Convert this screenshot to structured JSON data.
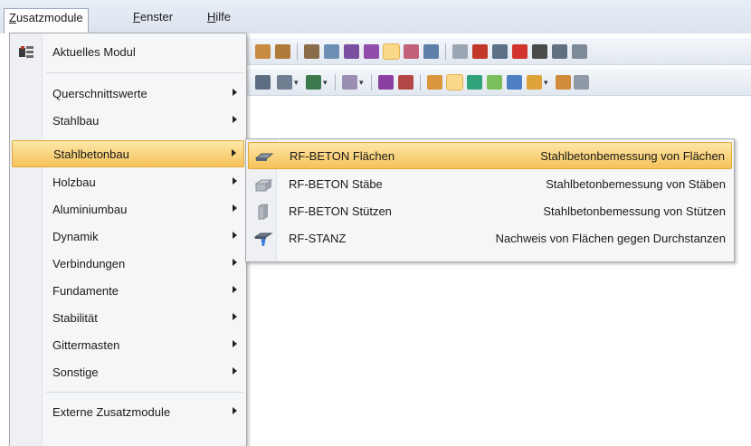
{
  "menubar": {
    "items": [
      {
        "mnemonic": "Z",
        "rest": "usatzmodule"
      },
      {
        "mnemonic": "F",
        "rest": "enster"
      },
      {
        "mnemonic": "H",
        "rest": "ilfe"
      }
    ]
  },
  "menu": {
    "items": [
      {
        "label": "Aktuelles Modul",
        "has_submenu": false,
        "icon": "module-icon"
      },
      {
        "label": "Querschnittswerte",
        "has_submenu": true
      },
      {
        "label": "Stahlbau",
        "has_submenu": true
      },
      {
        "label": "Stahlbetonbau",
        "has_submenu": true,
        "highlighted": true
      },
      {
        "label": "Holzbau",
        "has_submenu": true
      },
      {
        "label": "Aluminiumbau",
        "has_submenu": true
      },
      {
        "label": "Dynamik",
        "has_submenu": true
      },
      {
        "label": "Verbindungen",
        "has_submenu": true
      },
      {
        "label": "Fundamente",
        "has_submenu": true
      },
      {
        "label": "Stabilität",
        "has_submenu": true
      },
      {
        "label": "Gittermasten",
        "has_submenu": true
      },
      {
        "label": "Sonstige",
        "has_submenu": true
      },
      {
        "label": "Externe Zusatzmodule",
        "has_submenu": true
      }
    ]
  },
  "submenu": {
    "items": [
      {
        "name": "RF-BETON Flächen",
        "description": "Stahlbetonbemessung von Flächen",
        "icon": "surface-slab-icon",
        "highlighted": true
      },
      {
        "name": "RF-BETON Stäbe",
        "description": "Stahlbetonbemessung von Stäben",
        "icon": "beam-member-icon"
      },
      {
        "name": "RF-BETON Stützen",
        "description": "Stahlbetonbemessung von Stützen",
        "icon": "column-icon"
      },
      {
        "name": "RF-STANZ",
        "description": "Nachweis von Flächen gegen Durchstanzen",
        "icon": "punching-shear-icon"
      }
    ]
  },
  "colors": {
    "highlight": "#f6c25a",
    "menu_background": "#f5f6f8"
  }
}
